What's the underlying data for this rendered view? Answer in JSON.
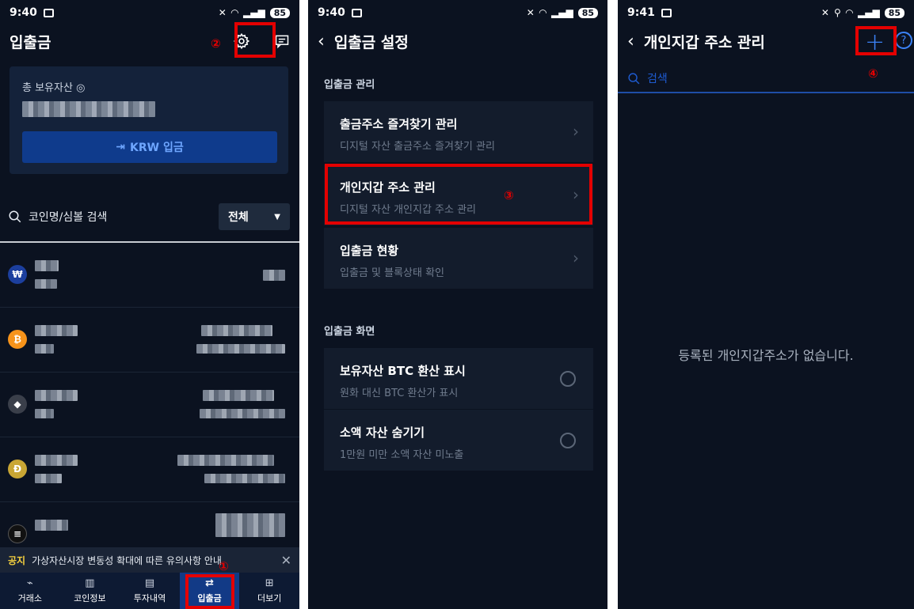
{
  "status": {
    "p1_time": "9:40",
    "p2_time": "9:40",
    "p3_time": "9:41",
    "battery": "85"
  },
  "panel1": {
    "title": "입출금",
    "total_assets_label": "총 보유자산",
    "krw_button": "KRW 입금",
    "search_placeholder": "코인명/심볼 검색",
    "filter_value": "전체",
    "notice_tag": "공지",
    "notice_text": "가상자산시장 변동성 확대에 따른 유의사항 안내",
    "tabs": [
      "거래소",
      "코인정보",
      "투자내역",
      "입출금",
      "더보기"
    ],
    "marker_tab": "①",
    "marker_settings": "②"
  },
  "panel2": {
    "title": "입출금 설정",
    "section1": "입출금 관리",
    "items": [
      {
        "title": "출금주소 즐겨찾기 관리",
        "sub": "디지털 자산 출금주소 즐겨찾기 관리"
      },
      {
        "title": "개인지갑 주소 관리",
        "sub": "디지털 자산 개인지갑 주소 관리"
      },
      {
        "title": "입출금 현황",
        "sub": "입출금 및 블록상태 확인"
      }
    ],
    "section2": "입출금 화면",
    "toggles": [
      {
        "title": "보유자산 BTC 환산 표시",
        "sub": "원화 대신 BTC 환산가 표시"
      },
      {
        "title": "소액 자산 숨기기",
        "sub": "1만원 미만 소액 자산 미노출"
      }
    ],
    "marker": "③"
  },
  "panel3": {
    "title": "개인지갑 주소 관리",
    "search_placeholder": "검색",
    "empty_text": "등록된 개인지갑주소가 없습니다.",
    "marker": "④"
  },
  "colors": {
    "background": "#0b1220",
    "highlight": "#e40000",
    "accent_blue": "#3b82f6",
    "tab_active": "#123a86"
  }
}
